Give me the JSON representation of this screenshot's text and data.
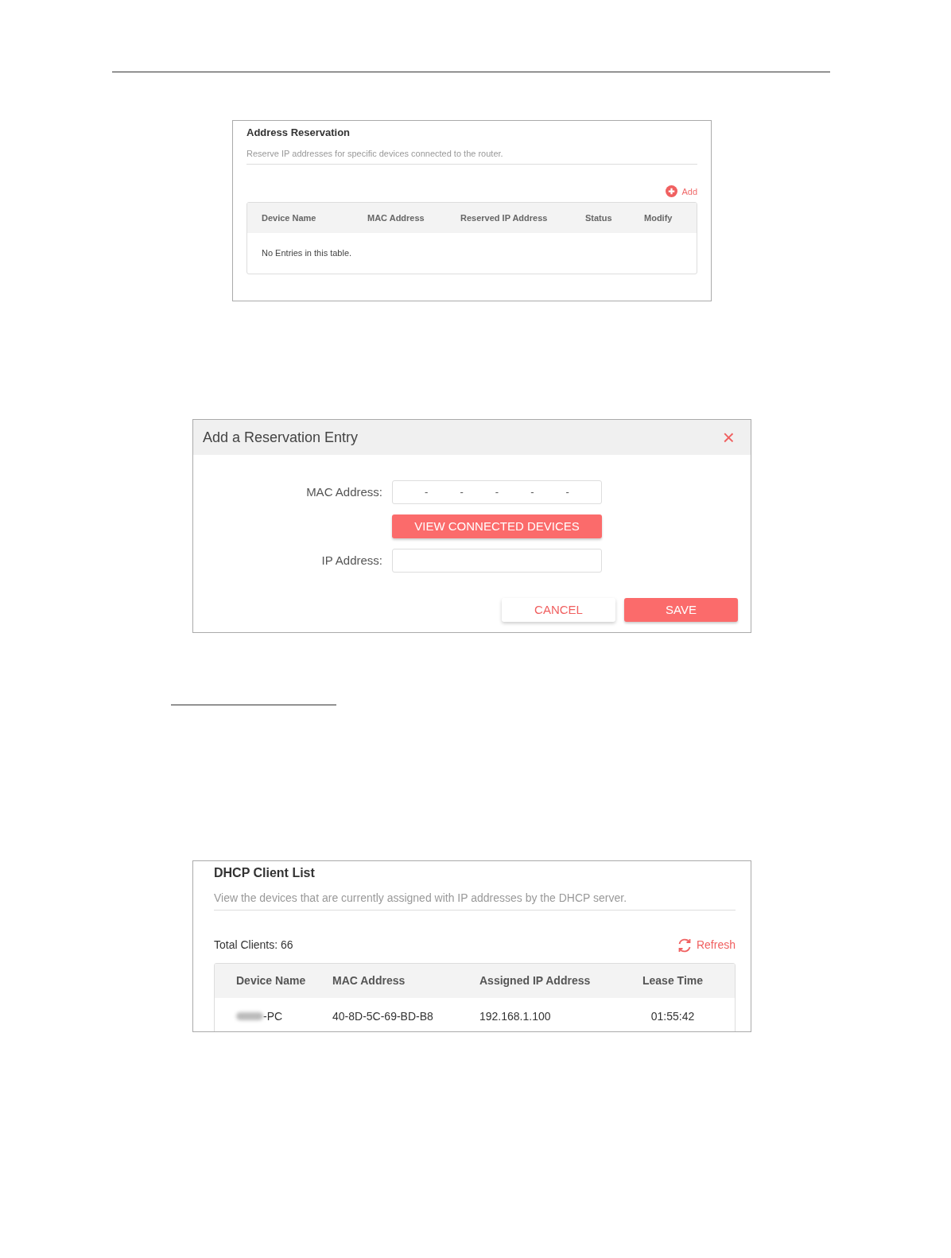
{
  "reservation_panel": {
    "title": "Address Reservation",
    "description": "Reserve IP addresses for specific devices connected to the router.",
    "add_button": "Add",
    "table": {
      "columns": [
        "Device Name",
        "MAC Address",
        "Reserved IP Address",
        "Status",
        "Modify"
      ],
      "empty_message": "No Entries in this table."
    }
  },
  "add_dialog": {
    "title": "Add a Reservation Entry",
    "close": "×",
    "fields": [
      {
        "kind": "mac",
        "label": "MAC Address:",
        "separators": [
          "-",
          "-",
          "-",
          "-",
          "-"
        ]
      },
      {
        "kind": "button",
        "label": "VIEW CONNECTED DEVICES"
      },
      {
        "kind": "text",
        "label": "IP Address:"
      }
    ],
    "buttons": [
      {
        "kind": "secondary",
        "label": "CANCEL"
      },
      {
        "kind": "primary",
        "label": "SAVE"
      }
    ]
  },
  "client_list": {
    "title": "DHCP Client List",
    "description": "View the devices that are currently assigned with IP addresses by the DHCP server.",
    "total": "Total Clients: 66",
    "refresh_button": "Refresh",
    "columns": [
      "Device Name",
      "MAC Address",
      "Assigned IP Address",
      "Lease Time"
    ],
    "rows": [
      {
        "redacted_name": true,
        "cells": [
          "-PC",
          "40-8D-5C-69-BD-B8",
          "192.168.1.100",
          "01:55:42"
        ]
      }
    ]
  }
}
